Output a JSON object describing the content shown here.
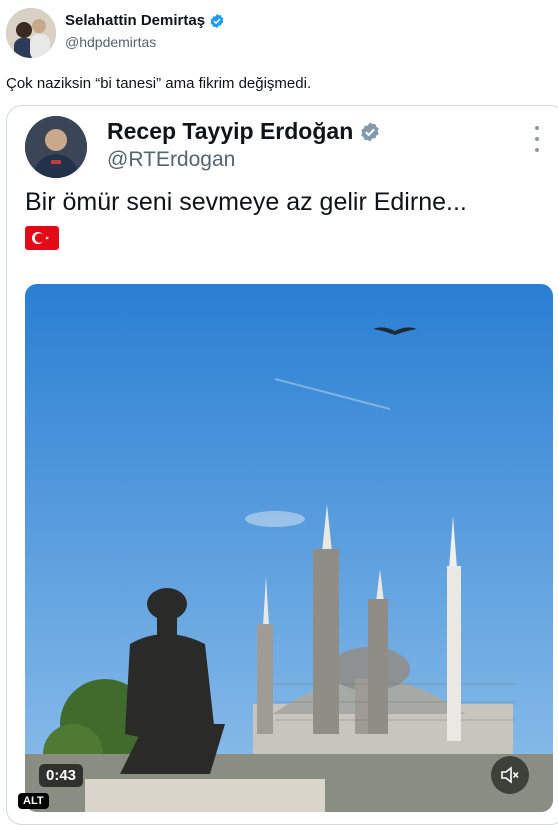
{
  "post": {
    "author_name": "Selahattin Demirtaş",
    "author_handle": "@hdpdemirtas",
    "text": "Çok naziksin “bi tanesi” ama fikrim değişmedi."
  },
  "quoted": {
    "author_name": "Recep Tayyip Erdoğan",
    "author_handle": "@RTErdogan",
    "text": "Bir ömür seni sevmeye az gelir Edirne...",
    "flag_icon": "turkey-flag-icon",
    "video": {
      "duration": "0:43",
      "alt_badge": "ALT",
      "mute_icon": "speaker-muted-icon"
    }
  },
  "colors": {
    "verified": "#1d9bf0",
    "verified_gov": "#829aab",
    "text": "#0f1419",
    "secondary": "#536471",
    "sky": "#2f86d6"
  }
}
